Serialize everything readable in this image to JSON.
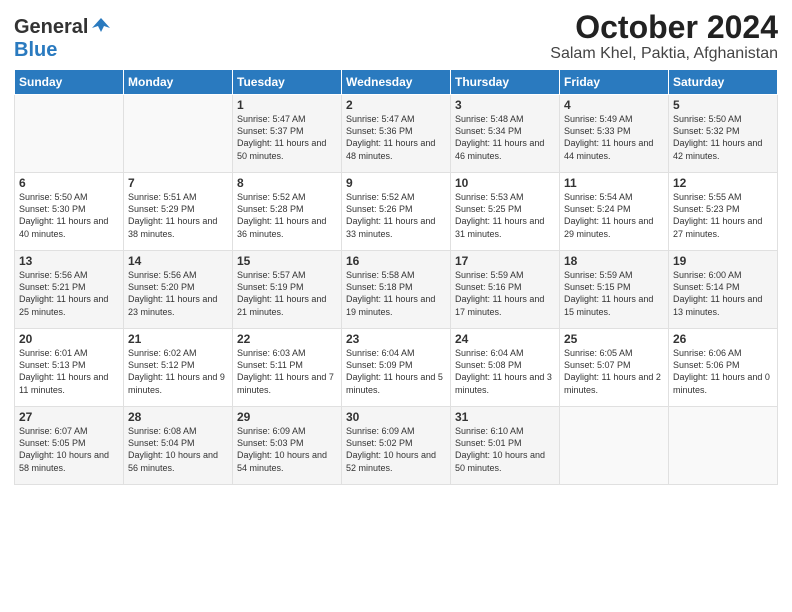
{
  "logo": {
    "general": "General",
    "blue": "Blue"
  },
  "title": "October 2024",
  "subtitle": "Salam Khel, Paktia, Afghanistan",
  "days_of_week": [
    "Sunday",
    "Monday",
    "Tuesday",
    "Wednesday",
    "Thursday",
    "Friday",
    "Saturday"
  ],
  "weeks": [
    [
      {
        "day": "",
        "info": ""
      },
      {
        "day": "",
        "info": ""
      },
      {
        "day": "1",
        "info": "Sunrise: 5:47 AM\nSunset: 5:37 PM\nDaylight: 11 hours and 50 minutes."
      },
      {
        "day": "2",
        "info": "Sunrise: 5:47 AM\nSunset: 5:36 PM\nDaylight: 11 hours and 48 minutes."
      },
      {
        "day": "3",
        "info": "Sunrise: 5:48 AM\nSunset: 5:34 PM\nDaylight: 11 hours and 46 minutes."
      },
      {
        "day": "4",
        "info": "Sunrise: 5:49 AM\nSunset: 5:33 PM\nDaylight: 11 hours and 44 minutes."
      },
      {
        "day": "5",
        "info": "Sunrise: 5:50 AM\nSunset: 5:32 PM\nDaylight: 11 hours and 42 minutes."
      }
    ],
    [
      {
        "day": "6",
        "info": "Sunrise: 5:50 AM\nSunset: 5:30 PM\nDaylight: 11 hours and 40 minutes."
      },
      {
        "day": "7",
        "info": "Sunrise: 5:51 AM\nSunset: 5:29 PM\nDaylight: 11 hours and 38 minutes."
      },
      {
        "day": "8",
        "info": "Sunrise: 5:52 AM\nSunset: 5:28 PM\nDaylight: 11 hours and 36 minutes."
      },
      {
        "day": "9",
        "info": "Sunrise: 5:52 AM\nSunset: 5:26 PM\nDaylight: 11 hours and 33 minutes."
      },
      {
        "day": "10",
        "info": "Sunrise: 5:53 AM\nSunset: 5:25 PM\nDaylight: 11 hours and 31 minutes."
      },
      {
        "day": "11",
        "info": "Sunrise: 5:54 AM\nSunset: 5:24 PM\nDaylight: 11 hours and 29 minutes."
      },
      {
        "day": "12",
        "info": "Sunrise: 5:55 AM\nSunset: 5:23 PM\nDaylight: 11 hours and 27 minutes."
      }
    ],
    [
      {
        "day": "13",
        "info": "Sunrise: 5:56 AM\nSunset: 5:21 PM\nDaylight: 11 hours and 25 minutes."
      },
      {
        "day": "14",
        "info": "Sunrise: 5:56 AM\nSunset: 5:20 PM\nDaylight: 11 hours and 23 minutes."
      },
      {
        "day": "15",
        "info": "Sunrise: 5:57 AM\nSunset: 5:19 PM\nDaylight: 11 hours and 21 minutes."
      },
      {
        "day": "16",
        "info": "Sunrise: 5:58 AM\nSunset: 5:18 PM\nDaylight: 11 hours and 19 minutes."
      },
      {
        "day": "17",
        "info": "Sunrise: 5:59 AM\nSunset: 5:16 PM\nDaylight: 11 hours and 17 minutes."
      },
      {
        "day": "18",
        "info": "Sunrise: 5:59 AM\nSunset: 5:15 PM\nDaylight: 11 hours and 15 minutes."
      },
      {
        "day": "19",
        "info": "Sunrise: 6:00 AM\nSunset: 5:14 PM\nDaylight: 11 hours and 13 minutes."
      }
    ],
    [
      {
        "day": "20",
        "info": "Sunrise: 6:01 AM\nSunset: 5:13 PM\nDaylight: 11 hours and 11 minutes."
      },
      {
        "day": "21",
        "info": "Sunrise: 6:02 AM\nSunset: 5:12 PM\nDaylight: 11 hours and 9 minutes."
      },
      {
        "day": "22",
        "info": "Sunrise: 6:03 AM\nSunset: 5:11 PM\nDaylight: 11 hours and 7 minutes."
      },
      {
        "day": "23",
        "info": "Sunrise: 6:04 AM\nSunset: 5:09 PM\nDaylight: 11 hours and 5 minutes."
      },
      {
        "day": "24",
        "info": "Sunrise: 6:04 AM\nSunset: 5:08 PM\nDaylight: 11 hours and 3 minutes."
      },
      {
        "day": "25",
        "info": "Sunrise: 6:05 AM\nSunset: 5:07 PM\nDaylight: 11 hours and 2 minutes."
      },
      {
        "day": "26",
        "info": "Sunrise: 6:06 AM\nSunset: 5:06 PM\nDaylight: 11 hours and 0 minutes."
      }
    ],
    [
      {
        "day": "27",
        "info": "Sunrise: 6:07 AM\nSunset: 5:05 PM\nDaylight: 10 hours and 58 minutes."
      },
      {
        "day": "28",
        "info": "Sunrise: 6:08 AM\nSunset: 5:04 PM\nDaylight: 10 hours and 56 minutes."
      },
      {
        "day": "29",
        "info": "Sunrise: 6:09 AM\nSunset: 5:03 PM\nDaylight: 10 hours and 54 minutes."
      },
      {
        "day": "30",
        "info": "Sunrise: 6:09 AM\nSunset: 5:02 PM\nDaylight: 10 hours and 52 minutes."
      },
      {
        "day": "31",
        "info": "Sunrise: 6:10 AM\nSunset: 5:01 PM\nDaylight: 10 hours and 50 minutes."
      },
      {
        "day": "",
        "info": ""
      },
      {
        "day": "",
        "info": ""
      }
    ]
  ]
}
